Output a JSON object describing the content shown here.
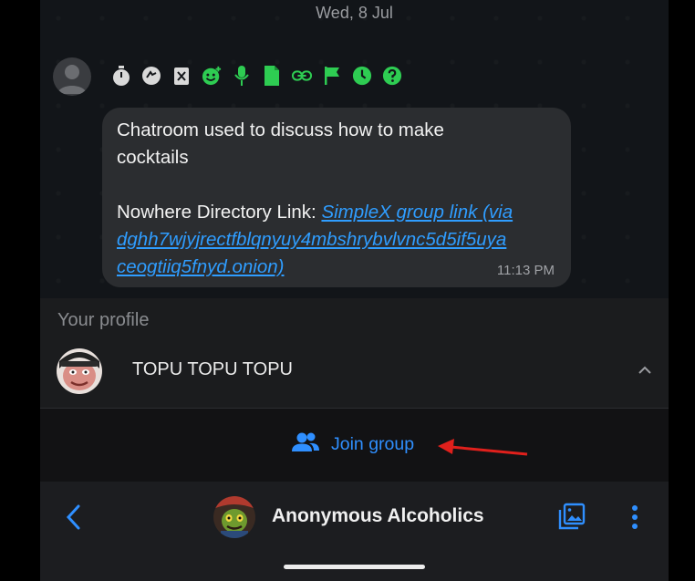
{
  "chat": {
    "date": "Wed, 8 Jul",
    "status_icons": [
      "timer-icon",
      "sync-icon",
      "delete-icon",
      "emoji-icon",
      "microphone-icon",
      "file-icon",
      "link-icon",
      "flag-icon",
      "clock-icon",
      "help-icon"
    ],
    "message": {
      "line1": "Chatroom used to discuss how to make",
      "line2": "cocktails",
      "directory_label": "Nowhere Directory Link: ",
      "link_part1": "SimpleX group link (via",
      "link_part2": "dghh7wjyjrectfblqnyuy4mbshrybvlvnc5d5if5uya",
      "link_part3": "ceogtiiq5fnyd.onion)",
      "time": "11:13 PM"
    }
  },
  "profile": {
    "heading": "Your profile",
    "name": "TOPU TOPU TOPU"
  },
  "join": {
    "label": "Join group"
  },
  "header": {
    "group_name": "Anonymous Alcoholics"
  },
  "colors": {
    "accent": "#2f8fff",
    "link": "#2f9dff",
    "icon_green": "#2ecc52",
    "annotation_red": "#e0201c"
  }
}
